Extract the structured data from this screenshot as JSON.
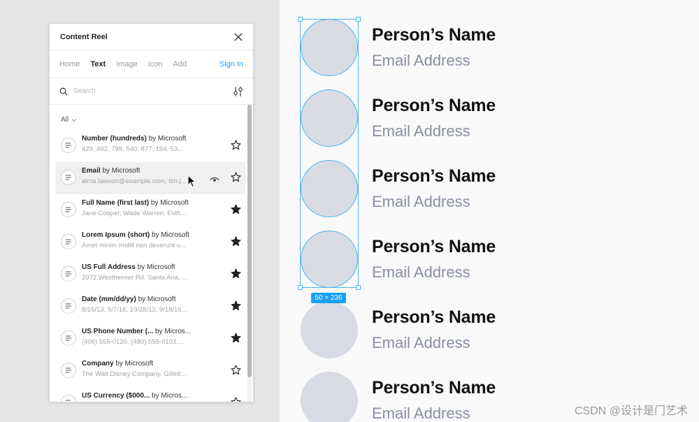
{
  "panel": {
    "title": "Content Reel",
    "tabs": [
      {
        "label": "Home"
      },
      {
        "label": "Text"
      },
      {
        "label": "Image"
      },
      {
        "label": "Icon"
      },
      {
        "label": "Add"
      }
    ],
    "active_tab": "Text",
    "sign_in_label": "Sign In",
    "search": {
      "placeholder": "Search",
      "value": ""
    },
    "filter_label": "All",
    "items": [
      {
        "title": "Number (hundreds)",
        "author": "by Microsoft",
        "preview": "429, 492, 798, 540, 877, 154, 53...",
        "favorited": false
      },
      {
        "title": "Email",
        "author": "by Microsoft",
        "preview": "alma.lawson@example.com, tim.j...",
        "favorited": false,
        "hovered": true
      },
      {
        "title": "Full Name (first last)",
        "author": "by Microsoft",
        "preview": "Jane Cooper, Wade Warren, Esth...",
        "favorited": true
      },
      {
        "title": "Lorem Ipsum (short)",
        "author": "by Microsoft",
        "preview": "Amet minim mollit non deserunt u...",
        "favorited": true
      },
      {
        "title": "US Full Address",
        "author": "by Microsoft",
        "preview": "2972 Westheimer Rd. Santa Ana, ...",
        "favorited": true
      },
      {
        "title": "Date (mm/dd/yy)",
        "author": "by Microsoft",
        "preview": "8/16/13, 5/7/16, 10/28/12, 9/18/16...",
        "favorited": true
      },
      {
        "title": "US Phone Number (...",
        "author": "by Micros...",
        "preview": "(406) 555-0120, (480) 555-0103,...",
        "favorited": true
      },
      {
        "title": "Company",
        "author": "by Microsoft",
        "preview": "The Walt Disney Company, Gillett...",
        "favorited": false
      },
      {
        "title": "US Currency ($000...",
        "author": "by Micros...",
        "preview": "",
        "favorited": false
      }
    ]
  },
  "canvas": {
    "rows": [
      {
        "name": "Person’s Name",
        "email": "Email Address",
        "selected": true
      },
      {
        "name": "Person’s Name",
        "email": "Email Address",
        "selected": true
      },
      {
        "name": "Person’s Name",
        "email": "Email Address",
        "selected": true
      },
      {
        "name": "Person’s Name",
        "email": "Email Address",
        "selected": true
      },
      {
        "name": "Person’s Name",
        "email": "Email Address",
        "selected": false
      },
      {
        "name": "Person’s Name",
        "email": "Email Address",
        "selected": false
      }
    ],
    "selection_size": "50 × 236"
  },
  "watermark": "CSDN @设计是门艺术",
  "colors": {
    "accent": "#18a0fb",
    "selection": "#4ab5f0",
    "avatar_fill": "#d9dbe4",
    "email_text": "#8a8fa0"
  },
  "icons": {
    "close": "close-icon",
    "search": "search-icon",
    "filter": "sliders-icon",
    "item": "text-lines-icon",
    "favorite_on": "star-filled-icon",
    "favorite_off": "star-outline-icon",
    "preview": "eye-icon",
    "dropdown": "chevron-down-icon"
  }
}
